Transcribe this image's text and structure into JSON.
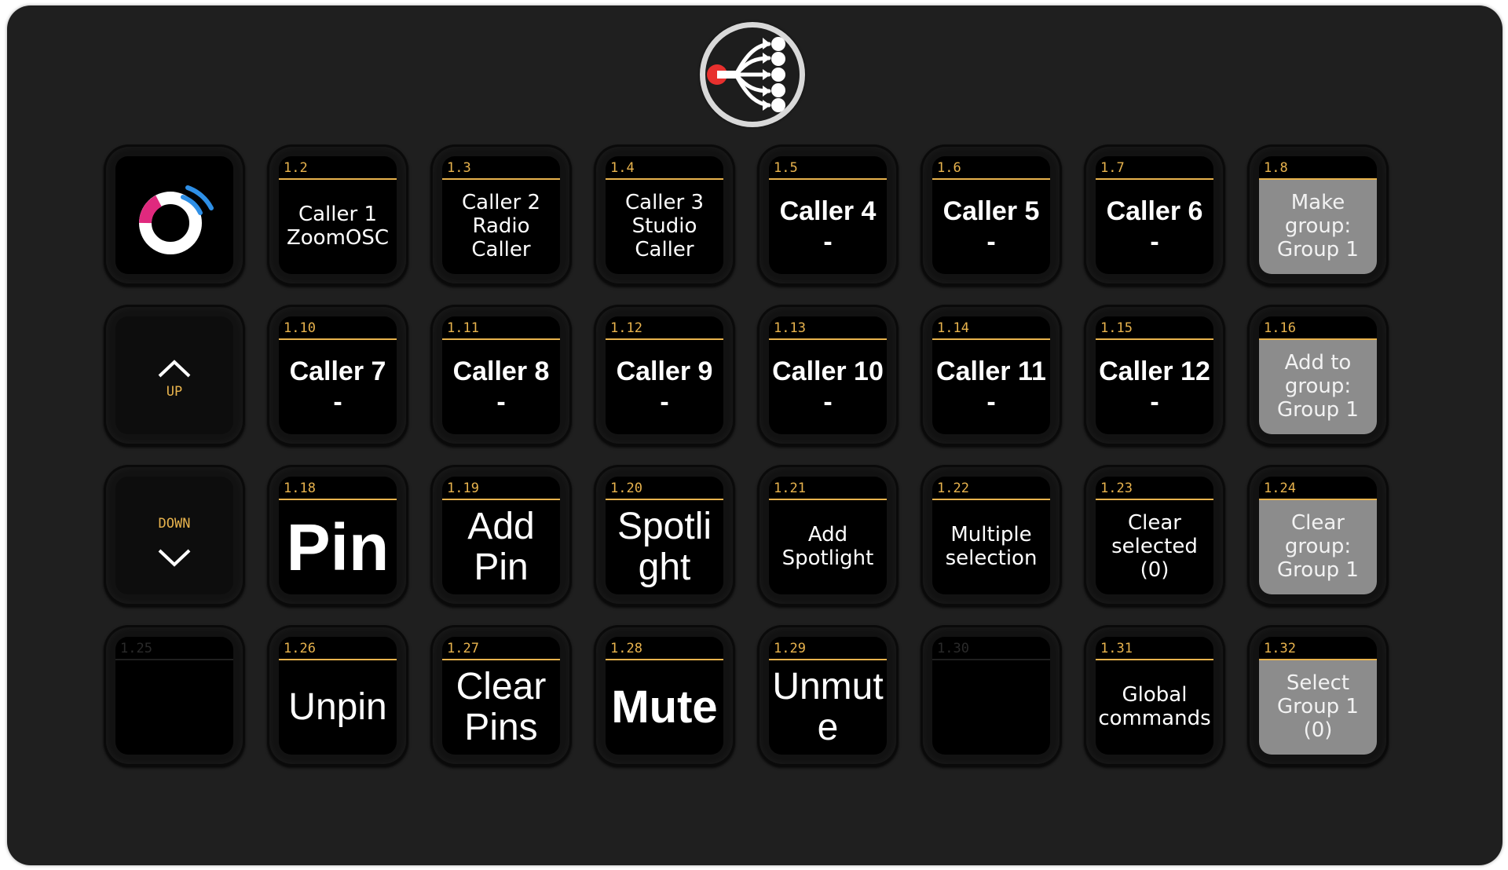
{
  "deck": {
    "app_logo_icon": "bitfocus-companion-logo-icon",
    "accent_color": "#e8b34d",
    "rows": [
      [
        {
          "type": "logo",
          "icon": "zoomosc-logo-icon"
        },
        {
          "num": "1.2",
          "text": "Caller 1\nZoomOSC",
          "style": "light"
        },
        {
          "num": "1.3",
          "text": "Caller 2\nRadio\nCaller",
          "style": "light"
        },
        {
          "num": "1.4",
          "text": "Caller 3\nStudio\nCaller",
          "style": "light"
        },
        {
          "num": "1.5",
          "text": "Caller 4\n-",
          "style": "bold"
        },
        {
          "num": "1.6",
          "text": "Caller 5\n-",
          "style": "bold"
        },
        {
          "num": "1.7",
          "text": "Caller 6\n-",
          "style": "bold"
        },
        {
          "num": "1.8",
          "text": "Make\ngroup:\nGroup 1",
          "style": "light",
          "bg": "grey"
        }
      ],
      [
        {
          "type": "up",
          "label": "UP",
          "icon": "chevron-up-icon"
        },
        {
          "num": "1.10",
          "text": "Caller 7\n-",
          "style": "bold"
        },
        {
          "num": "1.11",
          "text": "Caller 8\n-",
          "style": "bold"
        },
        {
          "num": "1.12",
          "text": "Caller 9\n-",
          "style": "bold"
        },
        {
          "num": "1.13",
          "text": "Caller 10\n-",
          "style": "bold"
        },
        {
          "num": "1.14",
          "text": "Caller 11\n-",
          "style": "bold"
        },
        {
          "num": "1.15",
          "text": "Caller 12\n-",
          "style": "bold"
        },
        {
          "num": "1.16",
          "text": "Add to\ngroup:\nGroup 1",
          "style": "light",
          "bg": "grey"
        }
      ],
      [
        {
          "type": "down",
          "label": "DOWN",
          "icon": "chevron-down-icon"
        },
        {
          "num": "1.18",
          "text": "Pin",
          "style": "huge"
        },
        {
          "num": "1.19",
          "text": "Add\nPin",
          "style": "big"
        },
        {
          "num": "1.20",
          "text": "Spotli\nght",
          "style": "big"
        },
        {
          "num": "1.21",
          "text": "Add\nSpotlight",
          "style": "light"
        },
        {
          "num": "1.22",
          "text": "Multiple\nselection",
          "style": "light"
        },
        {
          "num": "1.23",
          "text": "Clear\nselected\n(0)",
          "style": "light"
        },
        {
          "num": "1.24",
          "text": "Clear\ngroup:\nGroup 1",
          "style": "light",
          "bg": "grey"
        }
      ],
      [
        {
          "num": "1.25",
          "text": "",
          "style": "empty"
        },
        {
          "num": "1.26",
          "text": "Unpin",
          "style": "unpin"
        },
        {
          "num": "1.27",
          "text": "Clear\nPins",
          "style": "big"
        },
        {
          "num": "1.28",
          "text": "Mute",
          "style": "mute"
        },
        {
          "num": "1.29",
          "text": "Unmut\ne",
          "style": "big"
        },
        {
          "num": "1.30",
          "text": "",
          "style": "empty"
        },
        {
          "num": "1.31",
          "text": "Global\ncommands",
          "style": "light"
        },
        {
          "num": "1.32",
          "text": "Select\nGroup 1\n(0)",
          "style": "light",
          "bg": "grey"
        }
      ]
    ]
  }
}
